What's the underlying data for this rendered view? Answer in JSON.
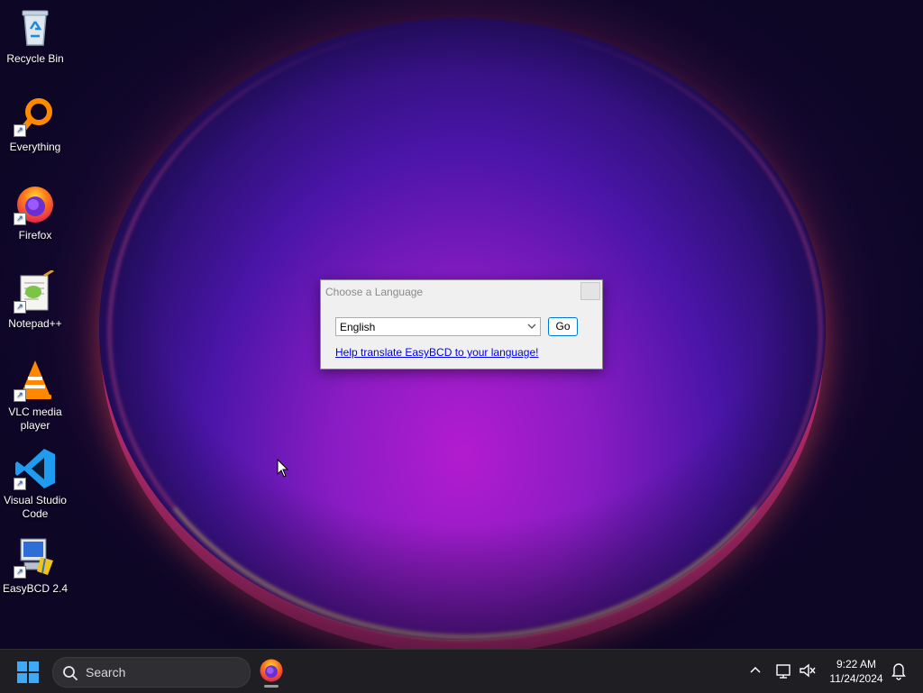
{
  "desktop": {
    "icons": [
      {
        "label": "Recycle Bin",
        "icon": "recycle-bin-icon"
      },
      {
        "label": "Everything",
        "icon": "everything-search-icon"
      },
      {
        "label": "Firefox",
        "icon": "firefox-icon"
      },
      {
        "label": "Notepad++",
        "icon": "notepadpp-icon"
      },
      {
        "label": "VLC media player",
        "icon": "vlc-icon"
      },
      {
        "label": "Visual Studio Code",
        "icon": "vscode-icon"
      },
      {
        "label": "EasyBCD 2.4",
        "icon": "easybcd-icon"
      }
    ]
  },
  "dialog": {
    "title": "Choose a Language",
    "select_value": "English",
    "go_label": "Go",
    "help_link": "Help translate EasyBCD to your language!"
  },
  "taskbar": {
    "search_label": "Search",
    "time": "9:22 AM",
    "date": "11/24/2024"
  },
  "colors": {
    "accent": "#0078d4",
    "link": "#0000ee",
    "taskbar_bg": "#1f1f23"
  }
}
